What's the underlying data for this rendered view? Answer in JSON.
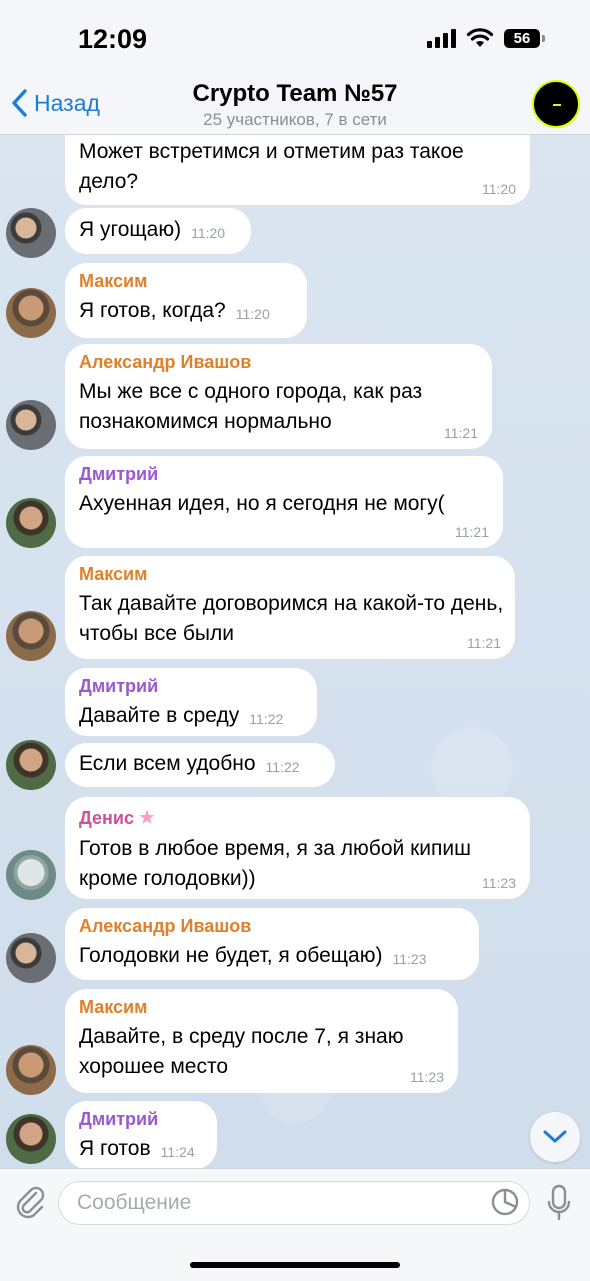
{
  "status_bar": {
    "time": "12:09",
    "battery": "56"
  },
  "header": {
    "back_label": "Назад",
    "title": "Crypto Team №57",
    "subtitle": "25 участников, 7 в сети"
  },
  "messages": [
    {
      "sender": "",
      "text": "Может встретимся и отметим раз такое дело?",
      "time": "11:20"
    },
    {
      "sender": "",
      "text": "Я угощаю)",
      "time": "11:20"
    },
    {
      "sender": "Максим",
      "text": "Я готов,  когда?",
      "time": "11:20"
    },
    {
      "sender": "Александр Ивашов",
      "text": "Мы же все с одного города, как раз познакомимся нормально",
      "time": "11:21"
    },
    {
      "sender": "Дмитрий",
      "text": "Ахуенная идея, но я сегодня не могу(",
      "time": "11:21"
    },
    {
      "sender": "Максим",
      "text": "Так давайте договоримся на какой-то день, чтобы все были",
      "time": "11:21"
    },
    {
      "sender": "Дмитрий",
      "text": "Давайте в среду",
      "time": "11:22"
    },
    {
      "sender": "",
      "text": "Если всем удобно",
      "time": "11:22"
    },
    {
      "sender": "Денис",
      "text": "Готов в любое время, я за любой кипиш кроме голодовки))",
      "time": "11:23"
    },
    {
      "sender": "Александр Ивашов",
      "text": "Голодовки не будет, я обещаю)",
      "time": "11:23"
    },
    {
      "sender": "Максим",
      "text": "Давайте, в среду после 7, я знаю хорошее место",
      "time": "11:23"
    },
    {
      "sender": "Дмитрий",
      "text": "Я готов",
      "time": "11:24"
    }
  ],
  "sender_colors": {
    "Максим": "#e0802b",
    "Александр Ивашов": "#e0802b",
    "Дмитрий": "#9b59d0",
    "Денис": "#d04f9c"
  },
  "input": {
    "placeholder": "Сообщение"
  },
  "icons": [
    "chevron-left-icon",
    "paperclip-icon",
    "sticker-icon",
    "microphone-icon",
    "chevron-down-icon"
  ]
}
